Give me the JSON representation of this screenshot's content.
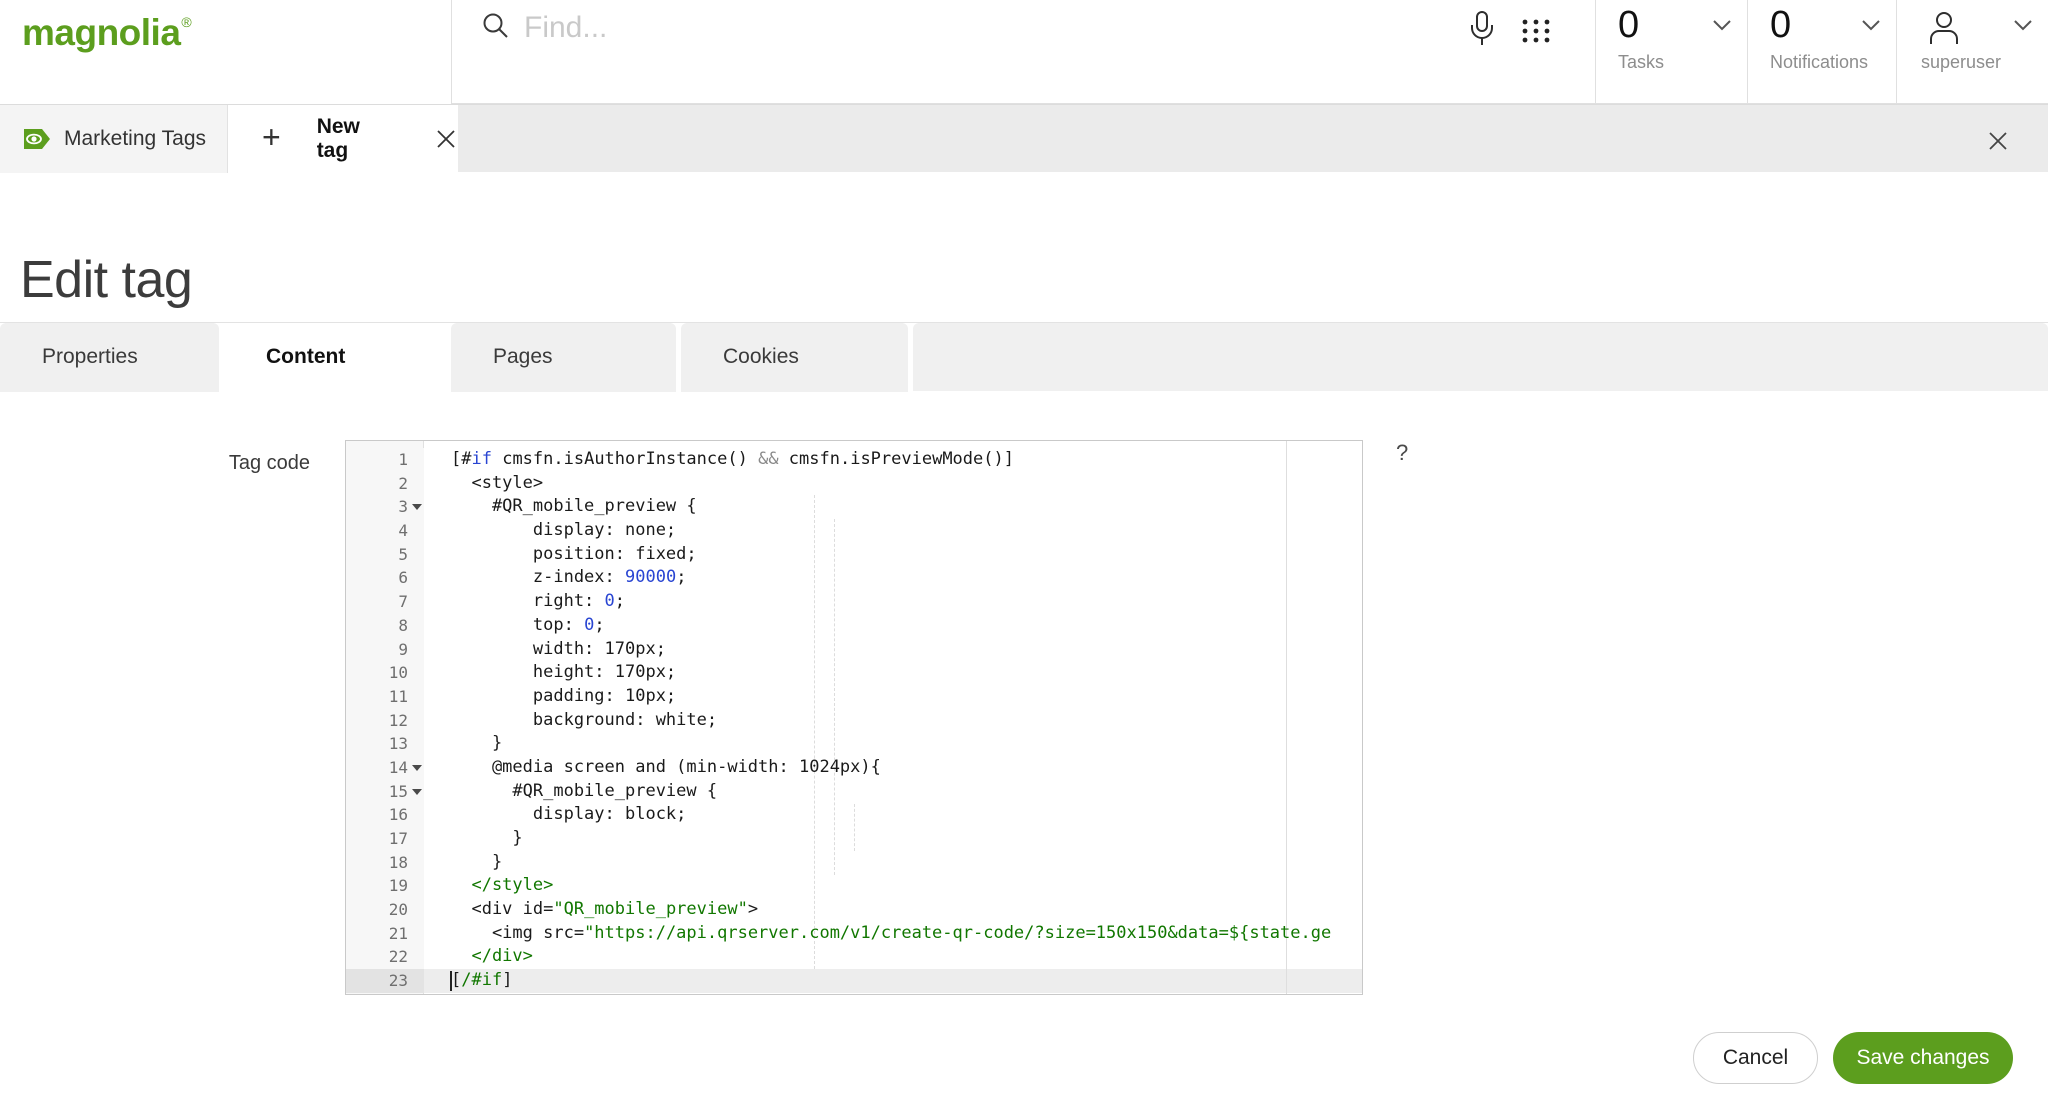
{
  "colors": {
    "brand_green": "#5c9e1e",
    "token_blue": "#2945d2",
    "token_green": "#117700",
    "tab_active_bg": "#ffffff",
    "tab_inactive_bg": "#f0f0f0"
  },
  "topbar": {
    "brand": "magnolia",
    "brand_reg": "®",
    "search_placeholder": "Find...",
    "tasks": {
      "count": "0",
      "label": "Tasks"
    },
    "notifications": {
      "count": "0",
      "label": "Notifications"
    },
    "user": {
      "label": "superuser"
    }
  },
  "tabbar": {
    "tabs": [
      {
        "label": "Marketing Tags"
      },
      {
        "label": "New tag"
      }
    ],
    "plus_glyph": "+"
  },
  "page": {
    "title": "Edit tag",
    "help_glyph": "?"
  },
  "subtabs": [
    {
      "label": "Properties",
      "active": false
    },
    {
      "label": "Content",
      "active": true
    },
    {
      "label": "Pages",
      "active": false
    },
    {
      "label": "Cookies",
      "active": false
    }
  ],
  "form": {
    "field_label": "Tag code"
  },
  "actions": {
    "cancel": "Cancel",
    "save": "Save changes"
  },
  "editor": {
    "lines": [
      {
        "n": "1",
        "tokens": [
          [
            "p",
            "[#"
          ],
          [
            "k",
            "if"
          ],
          [
            "p",
            " cmsfn.isAuthorInstance() "
          ],
          [
            "o",
            "&&"
          ],
          [
            "p",
            " cmsfn.isPreviewMode()]"
          ]
        ]
      },
      {
        "n": "2",
        "tokens": [
          [
            "p",
            "  <style>"
          ]
        ]
      },
      {
        "n": "3",
        "fold": true,
        "tokens": [
          [
            "p",
            "    #QR_mobile_preview {"
          ]
        ]
      },
      {
        "n": "4",
        "tokens": [
          [
            "p",
            "        display: none;"
          ]
        ]
      },
      {
        "n": "5",
        "tokens": [
          [
            "p",
            "        position: fixed;"
          ]
        ]
      },
      {
        "n": "6",
        "tokens": [
          [
            "p",
            "        z-index: "
          ],
          [
            "n",
            "90000"
          ],
          [
            "p",
            ";"
          ]
        ]
      },
      {
        "n": "7",
        "tokens": [
          [
            "p",
            "        right: "
          ],
          [
            "n",
            "0"
          ],
          [
            "p",
            ";"
          ]
        ]
      },
      {
        "n": "8",
        "tokens": [
          [
            "p",
            "        top: "
          ],
          [
            "n",
            "0"
          ],
          [
            "p",
            ";"
          ]
        ]
      },
      {
        "n": "9",
        "tokens": [
          [
            "p",
            "        width: 170px;"
          ]
        ]
      },
      {
        "n": "10",
        "tokens": [
          [
            "p",
            "        height: 170px;"
          ]
        ]
      },
      {
        "n": "11",
        "tokens": [
          [
            "p",
            "        padding: 10px;"
          ]
        ]
      },
      {
        "n": "12",
        "tokens": [
          [
            "p",
            "        background: white;"
          ]
        ]
      },
      {
        "n": "13",
        "tokens": [
          [
            "p",
            "    }"
          ]
        ]
      },
      {
        "n": "14",
        "fold": true,
        "tokens": [
          [
            "p",
            "    @media screen and (min-width: 1024px){"
          ]
        ]
      },
      {
        "n": "15",
        "fold": true,
        "tokens": [
          [
            "p",
            "      #QR_mobile_preview {"
          ]
        ]
      },
      {
        "n": "16",
        "tokens": [
          [
            "p",
            "        display: block;"
          ]
        ]
      },
      {
        "n": "17",
        "tokens": [
          [
            "p",
            "      }"
          ]
        ]
      },
      {
        "n": "18",
        "tokens": [
          [
            "p",
            "    }"
          ]
        ]
      },
      {
        "n": "19",
        "tokens": [
          [
            "g",
            "  </style>"
          ]
        ]
      },
      {
        "n": "20",
        "tokens": [
          [
            "p",
            "  <div id="
          ],
          [
            "g",
            "\"QR_mobile_preview\""
          ],
          [
            "p",
            ">"
          ]
        ]
      },
      {
        "n": "21",
        "tokens": [
          [
            "p",
            "    <img src="
          ],
          [
            "g",
            "\"https://api.qrserver.com/v1/create-qr-code/?size=150x150&data=${state.ge"
          ]
        ]
      },
      {
        "n": "22",
        "tokens": [
          [
            "g",
            "  </div>"
          ]
        ]
      },
      {
        "n": "23",
        "active": true,
        "cursor": true,
        "tokens": [
          [
            "p",
            "["
          ],
          [
            "g",
            "/#if"
          ],
          [
            "p",
            "]"
          ]
        ]
      }
    ]
  }
}
